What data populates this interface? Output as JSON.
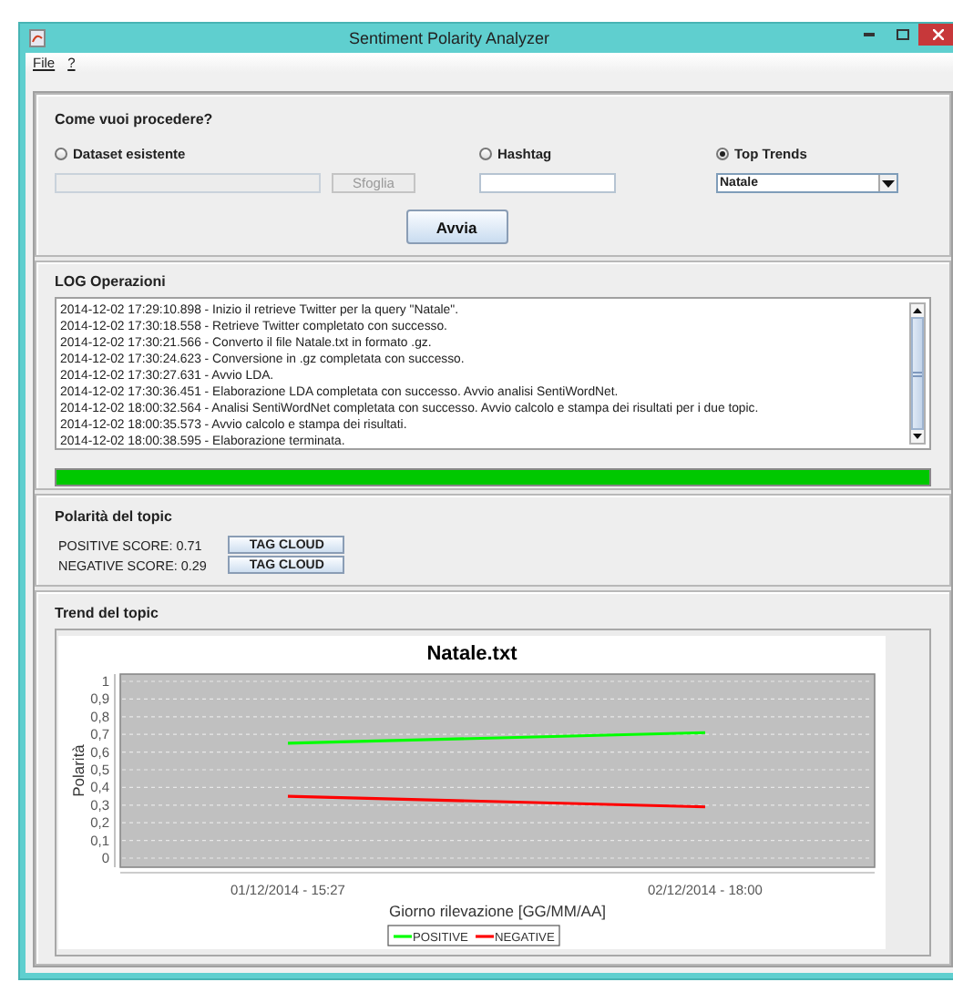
{
  "window": {
    "title": "Sentiment Polarity Analyzer"
  },
  "menu": [
    {
      "label": "File"
    },
    {
      "label": "?"
    }
  ],
  "source": {
    "title": "Come vuoi procedere?",
    "options": [
      {
        "kind": "file",
        "label": "Dataset esistente",
        "selected": false,
        "button": "Sfoglia",
        "disabled": true
      },
      {
        "kind": "text",
        "label": "Hashtag",
        "selected": false,
        "disabled": false
      },
      {
        "kind": "select",
        "label": "Top Trends",
        "selected": true,
        "value": "Natale",
        "disabled": false
      }
    ],
    "start_button": "Avvia"
  },
  "log": {
    "title": "LOG Operazioni",
    "lines": [
      "2014-12-02 17:29:10.898 - Inizio il retrieve Twitter per la query \"Natale\".",
      "2014-12-02 17:30:18.558 - Retrieve Twitter completato con successo.",
      "2014-12-02 17:30:21.566 - Converto il file Natale.txt in formato .gz.",
      "2014-12-02 17:30:24.623 - Conversione in .gz completata con successo.",
      "2014-12-02 17:30:27.631 - Avvio LDA.",
      "2014-12-02 17:30:36.451 - Elaborazione LDA completata con successo. Avvio analisi SentiWordNet.",
      "2014-12-02 18:00:32.564 - Analisi SentiWordNet completata con successo. Avvio calcolo e stampa dei risultati per i due topic.",
      "2014-12-02 18:00:35.573 - Avvio calcolo e stampa dei risultati.",
      "2014-12-02 18:00:38.595 - Elaborazione terminata."
    ]
  },
  "progress": {
    "level": 1
  },
  "polarity": {
    "title": "Polarità del topic",
    "scores": [
      {
        "label": "POSITIVE SCORE: 0.71",
        "button": "TAG CLOUD"
      },
      {
        "label": "NEGATIVE SCORE: 0.29",
        "button": "TAG CLOUD"
      }
    ]
  },
  "trend": {
    "title": "Trend del topic",
    "chart_data": {
      "type": "line",
      "title": "Natale.txt",
      "xlabel": "Giorno rilevazione [GG/MM/AA]",
      "ylabel": "Polarità",
      "categories": [
        "01/12/2014 - 15:27",
        "02/12/2014 - 18:00"
      ],
      "series": [
        {
          "name": "POSITIVE",
          "color": "#00ff00",
          "values": [
            0.65,
            0.71
          ]
        },
        {
          "name": "NEGATIVE",
          "color": "#ff0000",
          "values": [
            0.35,
            0.29
          ]
        }
      ],
      "ylim": [
        0,
        1
      ],
      "grid": true,
      "legend": "bottom",
      "yticks": [
        {
          "value": 0,
          "label": "0"
        },
        {
          "value": 0.1,
          "label": "0,1"
        },
        {
          "value": 0.2,
          "label": "0,2"
        },
        {
          "value": 0.3,
          "label": "0,3"
        },
        {
          "value": 0.4,
          "label": "0,4"
        },
        {
          "value": 0.5,
          "label": "0,5"
        },
        {
          "value": 0.6,
          "label": "0,6"
        },
        {
          "value": 0.7,
          "label": "0,7"
        },
        {
          "value": 0.8,
          "label": "0,8"
        },
        {
          "value": 0.9,
          "label": "0,9"
        },
        {
          "value": 1,
          "label": "1"
        }
      ]
    }
  }
}
